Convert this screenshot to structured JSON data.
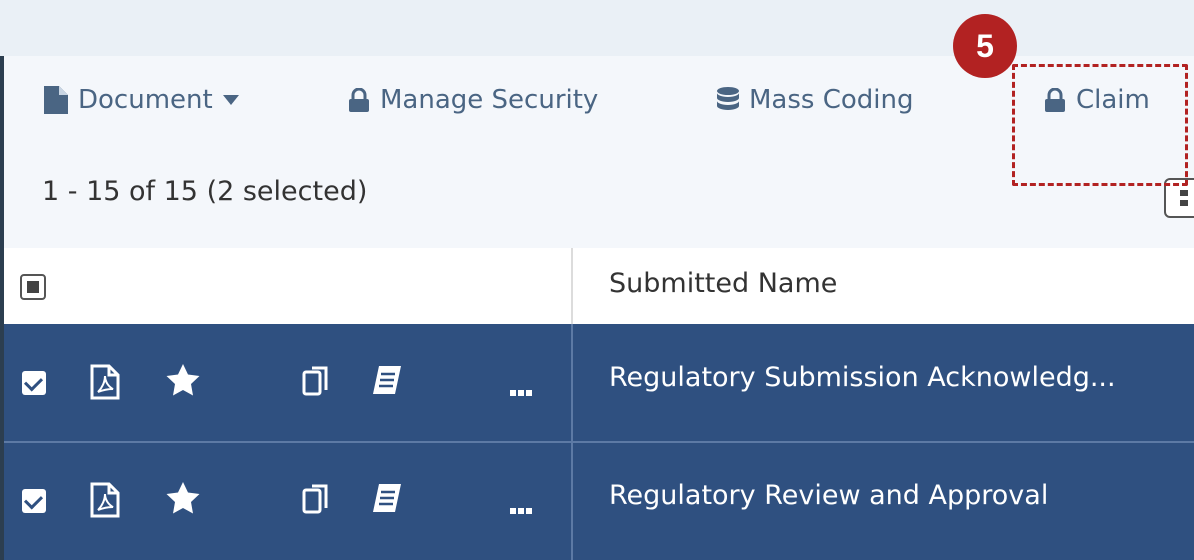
{
  "toolbar": {
    "document_label": "Document",
    "manage_security_label": "Manage Security",
    "mass_coding_label": "Mass Coding",
    "claim_label": "Claim"
  },
  "results": {
    "count_text": "1 - 15 of 15 (2 selected)"
  },
  "table": {
    "columns": [
      "Submitted Name"
    ],
    "rows": [
      {
        "submitted_name": "Regulatory Submission Acknowledg...",
        "selected": true
      },
      {
        "submitted_name": "Regulatory Review and Approval",
        "selected": true
      }
    ]
  },
  "callout": {
    "step_number": "5"
  },
  "colors": {
    "toolbar_text": "#4a6583",
    "selected_row": "#2f5080",
    "callout": "#b22222"
  },
  "icons": [
    "file-icon",
    "caret-down-icon",
    "lock-icon",
    "database-icon",
    "pdf-icon",
    "star-icon",
    "copy-icon",
    "book-icon",
    "more-icon",
    "grid-view-icon"
  ]
}
